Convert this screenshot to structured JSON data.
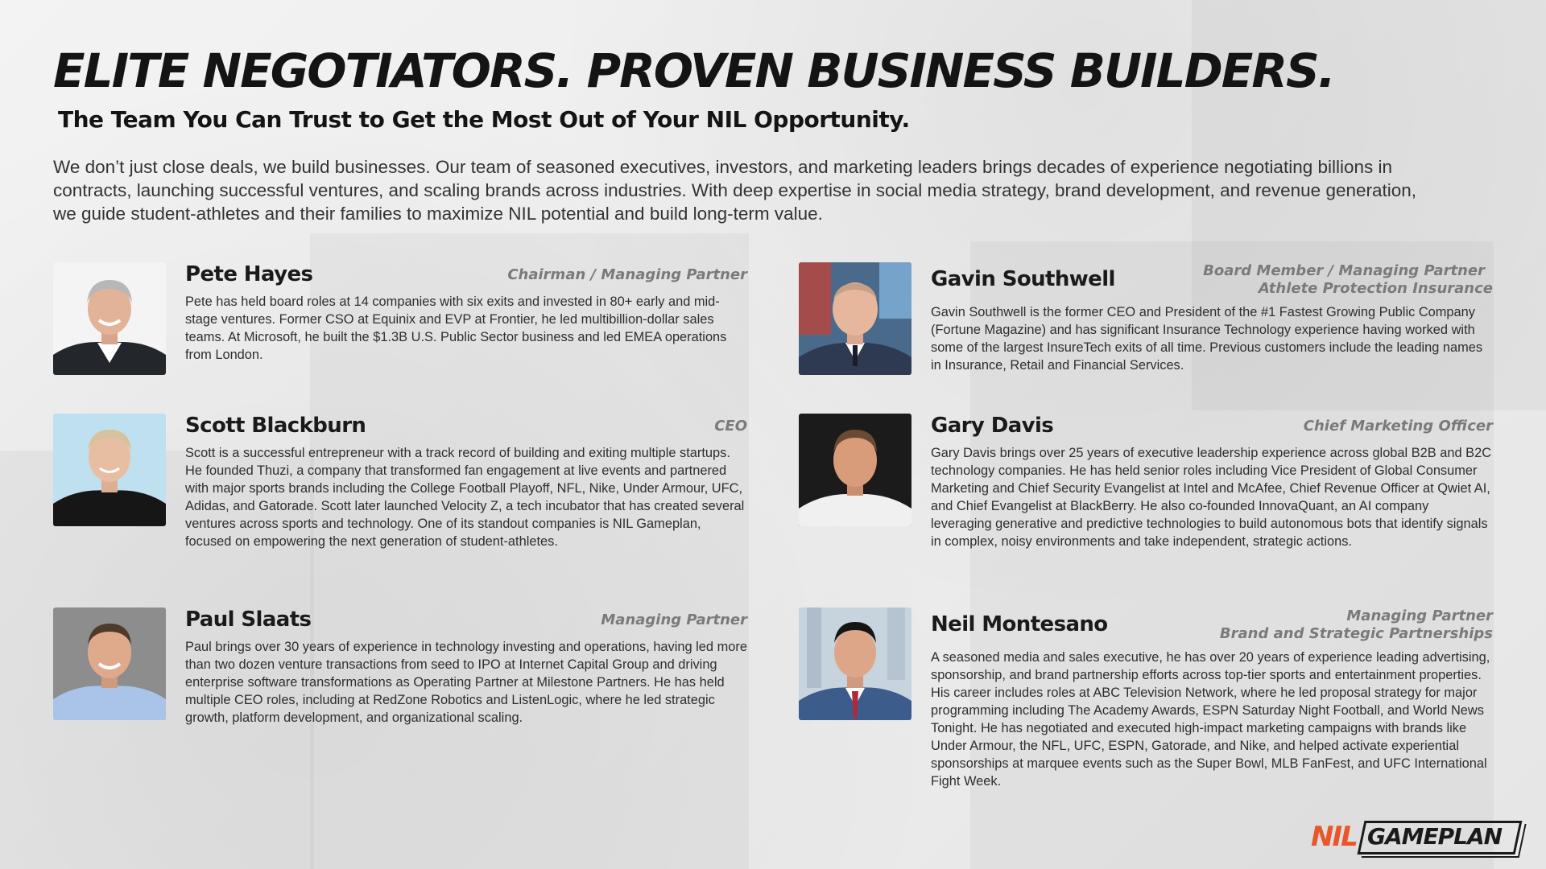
{
  "headline": "ELITE NEGOTIATORS. PROVEN BUSINESS BUILDERS.",
  "subheadline": "The Team You Can Trust to Get the Most Out of Your NIL Opportunity.",
  "intro": "We don’t just close deals, we build businesses. Our team of seasoned executives, investors, and marketing leaders brings decades of experience negotiating billions in contracts, launching successful ventures, and scaling brands across industries. With deep expertise in social media strategy, brand development, and revenue generation, we guide student-athletes and their families to maximize NIL potential and build long-term value.",
  "team": {
    "pete": {
      "name": "Pete Hayes",
      "role": "Chairman / Managing Partner",
      "bio": "Pete has held board roles at 14 companies with six exits and invested in 80+ early and mid-stage ventures. Former CSO at Equinix and EVP at Frontier, he led multibillion-dollar sales teams. At Microsoft, he built the $1.3B U.S. Public Sector business and led EMEA operations from London."
    },
    "gavin": {
      "name": "Gavin Southwell",
      "role": "Board Member / Managing Partner",
      "role2": "Athlete Protection Insurance",
      "bio": "Gavin Southwell is the former CEO and President of the #1 Fastest Growing Public Company (Fortune Magazine) and has significant Insurance Technology experience having worked with some of the largest InsureTech exits of all time. Previous customers include the leading names in Insurance, Retail and Financial Services."
    },
    "scott": {
      "name": "Scott Blackburn",
      "role": "CEO",
      "bio": "Scott is a successful entrepreneur with a track record of building and exiting multiple startups. He founded Thuzi, a company that transformed fan engagement at live events and partnered with major sports brands including the College Football Playoff, NFL, Nike, Under Armour, UFC, Adidas, and Gatorade. Scott later launched Velocity Z, a tech incubator that has created several ventures across sports and technology. One of its standout companies is NIL Gameplan, focused on empowering the next generation of student-athletes."
    },
    "gary": {
      "name": "Gary Davis",
      "role": "Chief Marketing Officer",
      "bio": "Gary Davis brings over 25 years of executive leadership experience across global B2B and B2C technology companies. He has held senior roles including Vice President of Global Consumer Marketing and Chief Security Evangelist at Intel and McAfee, Chief Revenue Officer at Qwiet AI, and Chief Evangelist at BlackBerry. He also co-founded InnovaQuant, an AI company leveraging generative and predictive technologies to build autonomous bots that identify signals in complex, noisy environments and take independent, strategic actions."
    },
    "paul": {
      "name": "Paul Slaats",
      "role": "Managing Partner",
      "bio": "Paul brings over 30 years of experience in technology investing and operations, having led more than two dozen venture transactions from seed to IPO at Internet Capital Group and driving enterprise software transformations as Operating Partner at Milestone Partners. He has held multiple CEO roles, including at RedZone Robotics and ListenLogic, where he led strategic growth, platform development, and organizational scaling."
    },
    "neil": {
      "name": "Neil Montesano",
      "role": "Managing Partner",
      "role2": "Brand and Strategic Partnerships",
      "bio": "A seasoned media and sales executive, he has over 20 years of experience leading advertising, sponsorship, and brand partnership efforts across top-tier sports and entertainment properties. His career includes roles at ABC Television Network, where he led proposal strategy for major programming including The Academy Awards, ESPN Saturday Night Football, and World News Tonight. He has negotiated and executed high-impact marketing campaigns with brands like Under Armour, the NFL, UFC, ESPN, Gatorade, and Nike, and helped activate experiential sponsorships at marquee events such as the Super Bowl, MLB FanFest, and UFC International Fight Week."
    }
  },
  "logo": {
    "nil": "NIL",
    "wordmark": "GAMEPLAN",
    "accent_color": "#e8562a"
  },
  "colors": {
    "headline": "#141414",
    "role_text": "#7a7a7a",
    "background": "#eeeeee"
  }
}
